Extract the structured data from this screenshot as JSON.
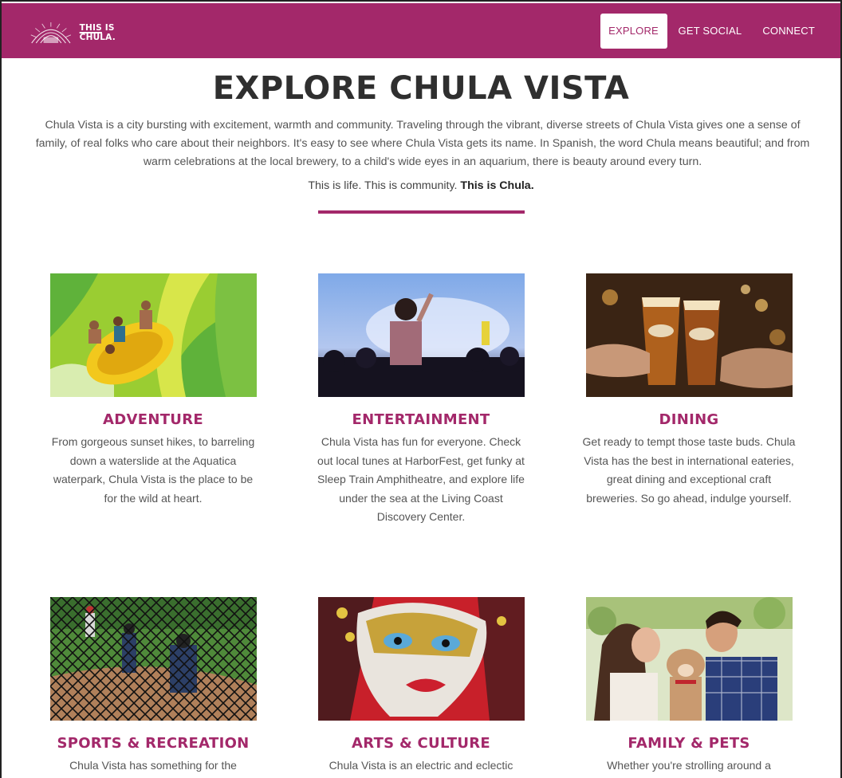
{
  "header": {
    "logo_text_u": "THIS",
    "logo_text_rest": " IS CHULA.",
    "nav": [
      {
        "label": "EXPLORE",
        "active": true
      },
      {
        "label": "GET SOCIAL",
        "active": false
      },
      {
        "label": "CONNECT",
        "active": false
      }
    ]
  },
  "main": {
    "title": "EXPLORE CHULA VISTA",
    "intro": "Chula Vista is a city bursting with excitement, warmth and community. Traveling through the vibrant, diverse streets of Chula Vista gives one a sense of family, of real folks who care about their neighbors. It's easy to see where Chula Vista gets its name. In Spanish, the word Chula means beautiful; and from warm celebrations at the local brewery, to a child's wide eyes in an aquarium, there is beauty around every turn.",
    "tagline_plain": "This is life. This is community. ",
    "tagline_bold": "This is Chula."
  },
  "cards": [
    {
      "title": "ADVENTURE",
      "text": "From gorgeous sunset hikes, to barreling down a waterslide at the Aquatica waterpark, Chula Vista is the place to be for the wild at heart."
    },
    {
      "title": "ENTERTAINMENT",
      "text": "Chula Vista has fun for everyone. Check out local tunes at HarborFest, get funky at Sleep Train Amphitheatre, and explore life under the sea at the Living Coast Discovery Center."
    },
    {
      "title": "DINING",
      "text": "Get ready to tempt those taste buds. Chula Vista has the best in international eateries, great dining and exceptional craft breweries. So go ahead, indulge yourself."
    },
    {
      "title": "SPORTS & RECREATION",
      "text": "Chula Vista has something for the"
    },
    {
      "title": "ARTS & CULTURE",
      "text": "Chula Vista is an electric and eclectic"
    },
    {
      "title": "FAMILY & PETS",
      "text": "Whether you're strolling around a"
    }
  ],
  "colors": {
    "brand": "#a3286a",
    "title": "#2f2f2f",
    "body_text": "#555555"
  },
  "icons": {
    "logo": "sun-rays-logo-icon"
  }
}
